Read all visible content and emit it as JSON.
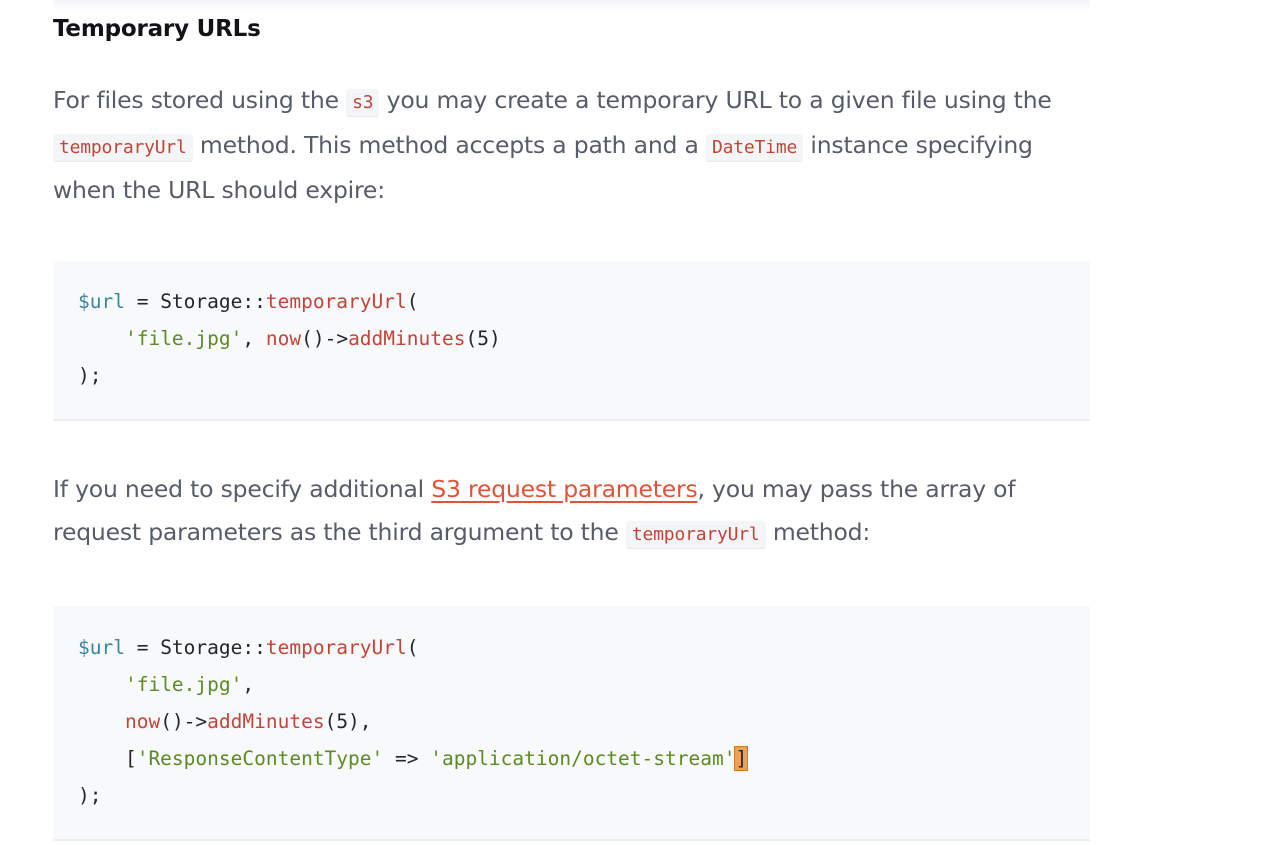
{
  "section": {
    "title": "Temporary URLs"
  },
  "paragraph1": {
    "t1": "For files stored using the ",
    "code1": "s3",
    "t2": " you may create a temporary URL to a given file using the ",
    "code2": "temporaryUrl",
    "t3": " method. This method accepts a path and a ",
    "code3": "DateTime",
    "t4": " instance specifying when the URL should expire:"
  },
  "codeblock1": {
    "lines": [
      [
        "$url",
        " = Storage::",
        "temporaryUrl",
        "("
      ],
      [
        "    ",
        "'file.jpg'",
        ", ",
        "now",
        "()->",
        "addMinutes",
        "(5)"
      ],
      [
        ");"
      ]
    ]
  },
  "paragraph2": {
    "t1": "If you need to specify additional ",
    "link": "S3 request parameters",
    "t2": ", you may pass the array of request parameters as the third argument to the ",
    "code1": "temporaryUrl",
    "t3": " method:"
  },
  "codeblock2": {
    "lines": [
      [
        "$url",
        " = Storage::",
        "temporaryUrl",
        "("
      ],
      [
        "    ",
        "'file.jpg'",
        ","
      ],
      [
        "    ",
        "now",
        "()->",
        "addMinutes",
        "(5),"
      ],
      [
        "    [",
        "'ResponseContentType'",
        " => ",
        "'application/octet-stream'",
        "]"
      ],
      [
        ");"
      ]
    ]
  },
  "colors": {
    "inline_code": "#c3453a",
    "variable": "#3a84a8",
    "function": "#c3453a",
    "string": "#5d8a24",
    "link": "#e0533a",
    "cursor_highlight": "#f0a050"
  }
}
